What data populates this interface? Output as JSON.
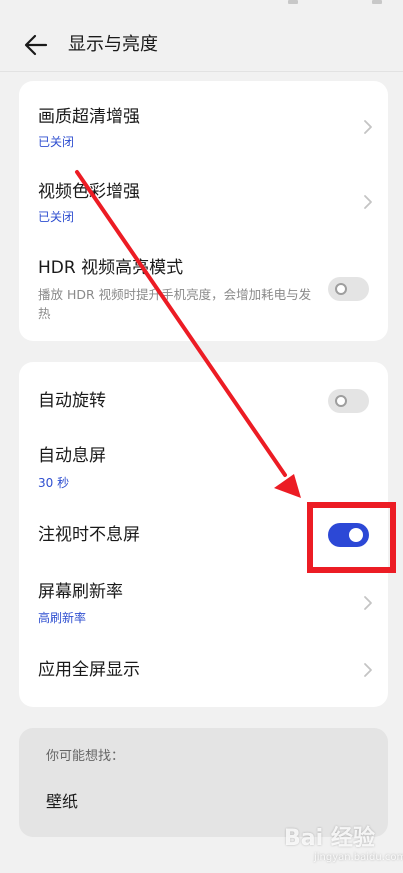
{
  "header": {
    "title": "显示与亮度",
    "back_icon": "arrow-left-icon"
  },
  "card_enhance": {
    "items": [
      {
        "title": "画质超清增强",
        "status": "已关闭",
        "control": "chevron"
      },
      {
        "title": "视频色彩增强",
        "status": "已关闭",
        "control": "chevron"
      },
      {
        "title": "HDR 视频高亮模式",
        "description": "播放 HDR 视频时提升手机亮度，会增加耗电与发热",
        "control": "toggle",
        "on": false
      }
    ]
  },
  "card_screen": {
    "items": [
      {
        "title": "自动旋转",
        "control": "toggle",
        "on": false
      },
      {
        "title": "自动息屏",
        "status": "30 秒",
        "control": "none"
      },
      {
        "title": "注视时不息屏",
        "control": "toggle",
        "on": true
      },
      {
        "title": "屏幕刷新率",
        "status": "高刷新率",
        "control": "chevron"
      },
      {
        "title": "应用全屏显示",
        "control": "chevron"
      }
    ]
  },
  "suggestions": {
    "label": "你可能想找：",
    "items": [
      "壁纸"
    ]
  },
  "annotation": {
    "color": "#ec1c24",
    "type": "arrow-and-box"
  },
  "watermark": {
    "text": "Bai 经验",
    "sub": "jingyan.baidu.com"
  },
  "colors": {
    "accent": "#2c48d6",
    "status_text": "#2f4fd0",
    "background": "#f1f1f1",
    "card": "#ffffff"
  }
}
